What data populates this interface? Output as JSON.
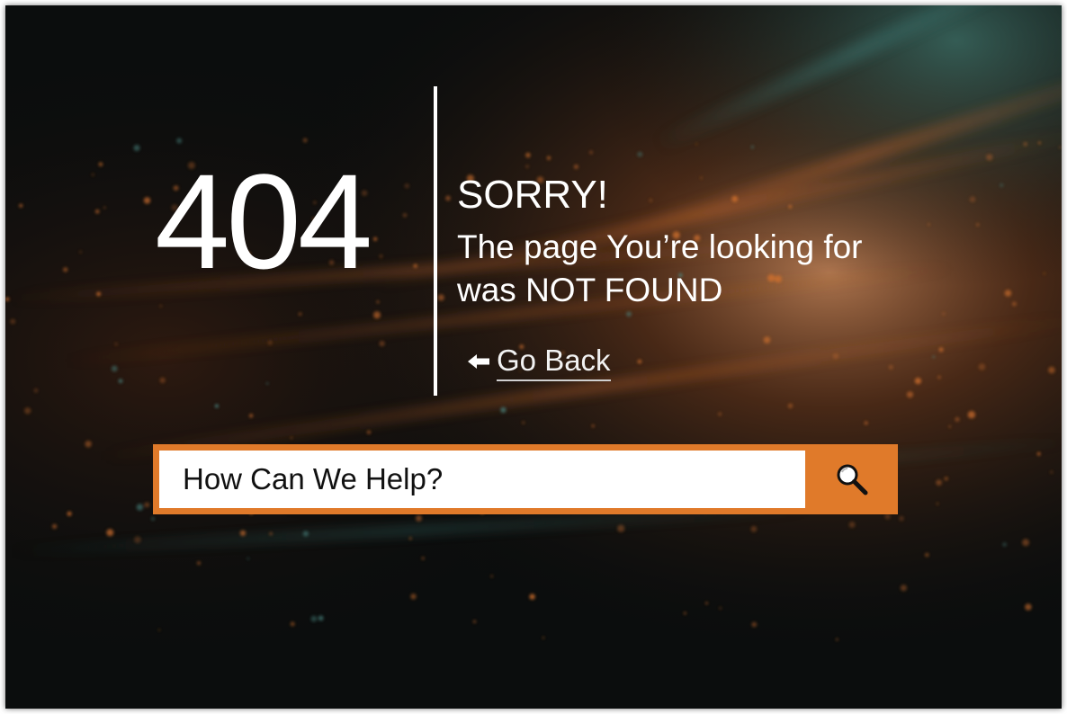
{
  "error": {
    "code": "404",
    "headline": "SORRY!",
    "message": "The page You’re looking for was NOT FOUND"
  },
  "navigation": {
    "go_back_label": "Go Back",
    "go_back_icon": "arrow-left-icon"
  },
  "search": {
    "placeholder": "How Can We Help?",
    "value": "",
    "button_icon": "search-icon"
  },
  "colors": {
    "accent": "#e07a2a",
    "text": "#ffffff",
    "background": "#0b0d0d"
  }
}
